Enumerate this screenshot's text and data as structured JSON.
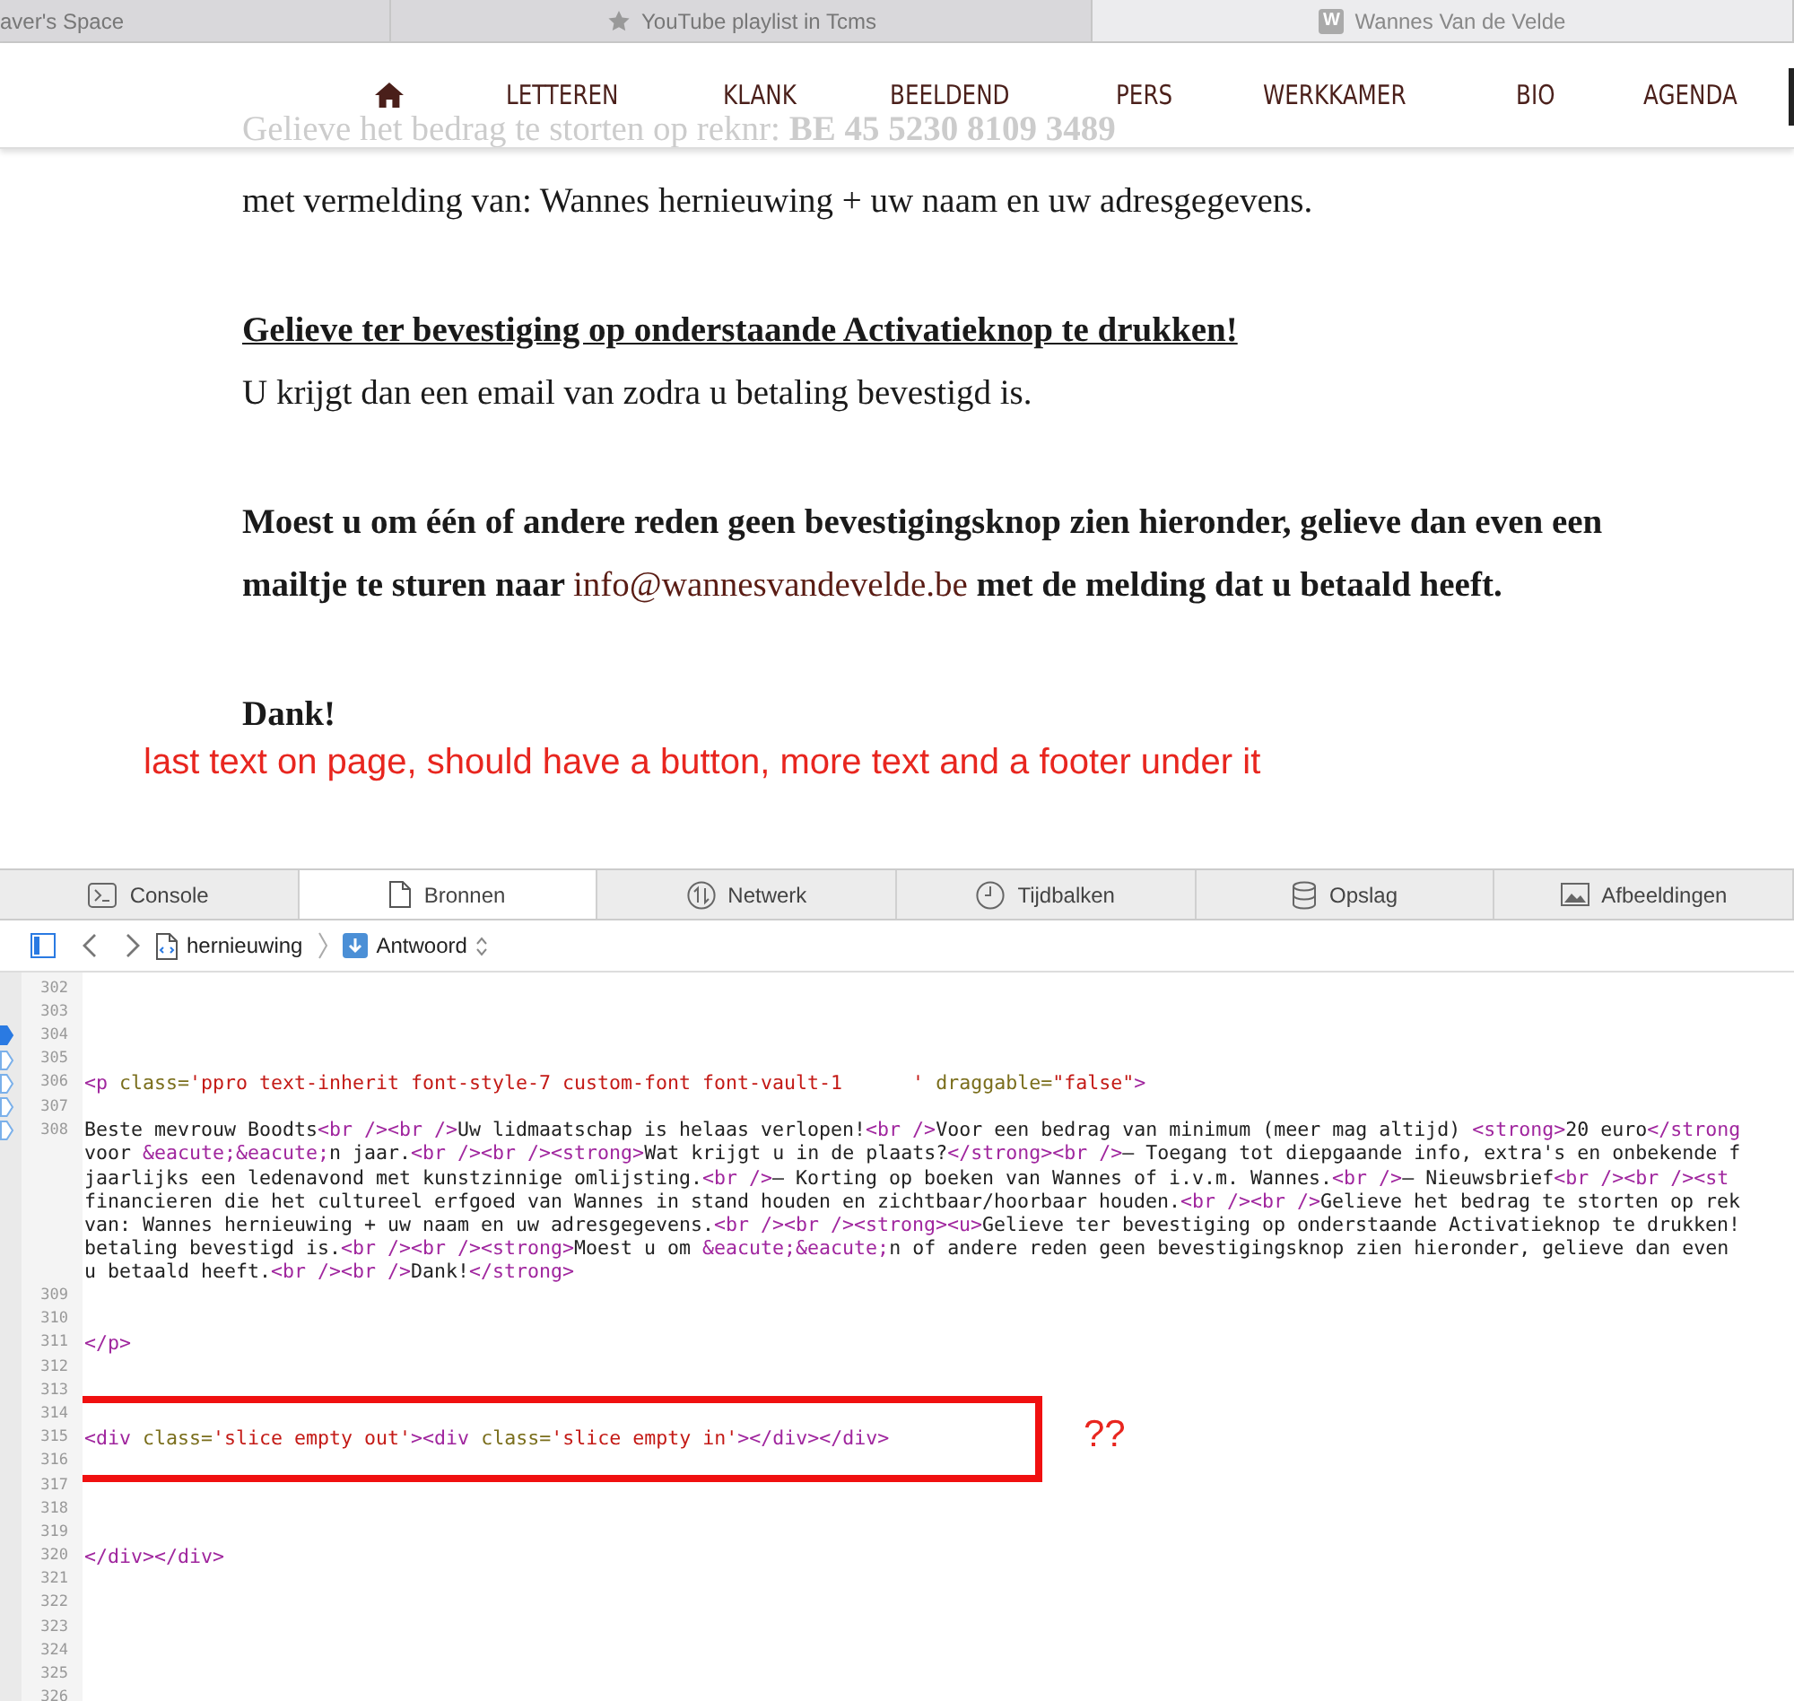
{
  "browser_tabs": [
    {
      "title": "aver's Space",
      "kind": "plain",
      "selected": false
    },
    {
      "title": "YouTube playlist in Tcms",
      "kind": "star",
      "selected": false
    },
    {
      "title": "Wannes Van de Velde",
      "kind": "letter",
      "icon_text": "W",
      "selected": true
    }
  ],
  "nav": {
    "items": [
      "LETTEREN",
      "KLANK",
      "BEELDEND",
      "PERS",
      "WERKKAMER",
      "BIO",
      "AGENDA"
    ]
  },
  "content": [
    {
      "kind": "faded",
      "text": "Gelieve het bedrag te storten op reknr: **BE 45 5230 8109 3489**"
    },
    {
      "kind": "plain",
      "text": "met vermelding van: Wannes hernieuwing + uw naam en uw adresgegevens."
    },
    {
      "kind": "gap"
    },
    {
      "kind": "underlined",
      "text": "Gelieve ter bevestiging op onderstaande Activatieknop te drukken!"
    },
    {
      "kind": "plain",
      "text": "U krijgt dan een email van zodra u betaling bevestigd is."
    },
    {
      "kind": "gap"
    },
    {
      "kind": "bold",
      "text": "Moest u om één of andere reden geen bevestigingsknop zien hieronder, gelieve dan even een mailtje te sturen naar ",
      "link": "info@wannesvandevelde.be",
      "after": " met de melding dat u betaald heeft."
    },
    {
      "kind": "gap"
    },
    {
      "kind": "bold",
      "text": "Dank!"
    }
  ],
  "annotation": "last text on page, should have a button, more text and a footer under it",
  "devtools": {
    "tabs": [
      {
        "label": "Console",
        "kind": "console",
        "selected": false
      },
      {
        "label": "Bronnen",
        "kind": "file",
        "selected": true
      },
      {
        "label": "Netwerk",
        "kind": "network",
        "selected": false
      },
      {
        "label": "Tijdbalken",
        "kind": "clock",
        "selected": false
      },
      {
        "label": "Opslag",
        "kind": "storage",
        "selected": false
      },
      {
        "label": "Afbeeldingen",
        "kind": "image",
        "selected": false
      }
    ],
    "breadcrumb": [
      {
        "label": "hernieuwing",
        "kind": "file",
        "chooser": false
      },
      {
        "label": "Antwoord",
        "kind": "download",
        "chooser": true
      }
    ],
    "lines": [
      {
        "number": "302"
      },
      {
        "number": "303"
      },
      {
        "number": "304",
        "breakpoint": true,
        "disabled": false
      },
      {
        "number": "305",
        "breakpoint": true,
        "disabled": true
      },
      {
        "number": "306",
        "breakpoint": true,
        "disabled": true,
        "tokens": [
          {
            "kind": "tag",
            "text": "<p "
          },
          {
            "kind": "attr",
            "text": "class="
          },
          {
            "kind": "value",
            "text": "'ppro text-inherit font-style-7 custom-font font-vault-1      '"
          },
          {
            "kind": "attr",
            "text": " draggable="
          },
          {
            "kind": "value",
            "text": "\"false\""
          },
          {
            "kind": "tag",
            "text": ">"
          }
        ]
      },
      {
        "number": "307",
        "breakpoint": true,
        "disabled": true
      },
      {
        "number": "308",
        "breakpoint": true,
        "disabled": true,
        "tokens": [
          {
            "kind": "text",
            "text": "Beste mevrouw Boodts"
          },
          {
            "kind": "tag",
            "text": "<br /><br />"
          },
          {
            "kind": "text",
            "text": "Uw lidmaatschap is helaas verlopen!"
          },
          {
            "kind": "tag",
            "text": "<br />"
          },
          {
            "kind": "text",
            "text": "Voor een bedrag van minimum (meer mag altijd) "
          },
          {
            "kind": "tag",
            "text": "<strong>"
          },
          {
            "kind": "text",
            "text": "20 euro"
          },
          {
            "kind": "tag",
            "text": "</strong"
          }
        ]
      },
      {
        "tokens": [
          {
            "kind": "text",
            "text": "voor "
          },
          {
            "kind": "tag",
            "text": "&eacute;&eacute;"
          },
          {
            "kind": "text",
            "text": "n jaar."
          },
          {
            "kind": "tag",
            "text": "<br /><br /><strong>"
          },
          {
            "kind": "text",
            "text": "Wat krijgt u in de plaats?"
          },
          {
            "kind": "tag",
            "text": "</strong><br />"
          },
          {
            "kind": "text",
            "text": "– Toegang tot diepgaande info, extra's en onbekende f"
          }
        ]
      },
      {
        "tokens": [
          {
            "kind": "text",
            "text": "jaarlijks een ledenavond met kunstzinnige omlijsting."
          },
          {
            "kind": "tag",
            "text": "<br />"
          },
          {
            "kind": "text",
            "text": "– Korting op boeken van Wannes of i.v.m. Wannes."
          },
          {
            "kind": "tag",
            "text": "<br />"
          },
          {
            "kind": "text",
            "text": "– Nieuwsbrief"
          },
          {
            "kind": "tag",
            "text": "<br /><br /><st"
          }
        ]
      },
      {
        "tokens": [
          {
            "kind": "text",
            "text": "financieren die het cultureel erfgoed van Wannes in stand houden en zichtbaar/hoorbaar houden."
          },
          {
            "kind": "tag",
            "text": "<br /><br />"
          },
          {
            "kind": "text",
            "text": "Gelieve het bedrag te storten op rek"
          }
        ]
      },
      {
        "tokens": [
          {
            "kind": "text",
            "text": "van: Wannes hernieuwing + uw naam en uw adresgegevens."
          },
          {
            "kind": "tag",
            "text": "<br /><br /><strong><u>"
          },
          {
            "kind": "text",
            "text": "Gelieve ter bevestiging op onderstaande Activatieknop te drukken!"
          }
        ]
      },
      {
        "tokens": [
          {
            "kind": "text",
            "text": "betaling bevestigd is."
          },
          {
            "kind": "tag",
            "text": "<br /><br /><strong>"
          },
          {
            "kind": "text",
            "text": "Moest u om "
          },
          {
            "kind": "tag",
            "text": "&eacute;&eacute;"
          },
          {
            "kind": "text",
            "text": "n of andere reden geen bevestigingsknop zien hieronder, gelieve dan even"
          }
        ]
      },
      {
        "tokens": [
          {
            "kind": "text",
            "text": "u betaald heeft."
          },
          {
            "kind": "tag",
            "text": "<br /><br />"
          },
          {
            "kind": "text",
            "text": "Dank!"
          },
          {
            "kind": "tag",
            "text": "</strong>"
          }
        ]
      },
      {
        "number": "309"
      },
      {
        "number": "310"
      },
      {
        "number": "311",
        "tokens": [
          {
            "kind": "tag",
            "text": "</p>"
          }
        ]
      },
      {
        "number": "312"
      },
      {
        "number": "313"
      },
      {
        "number": "314"
      },
      {
        "number": "315",
        "highlight": true,
        "tokens": [
          {
            "kind": "tag",
            "text": "<div "
          },
          {
            "kind": "attr",
            "text": "class="
          },
          {
            "kind": "value",
            "text": "'slice empty out'"
          },
          {
            "kind": "tag",
            "text": "><div "
          },
          {
            "kind": "attr",
            "text": "class="
          },
          {
            "kind": "value",
            "text": "'slice empty in'"
          },
          {
            "kind": "tag",
            "text": "></div></div>"
          }
        ]
      },
      {
        "number": "316"
      },
      {
        "number": "317"
      },
      {
        "number": "318"
      },
      {
        "number": "319"
      },
      {
        "number": "320",
        "tokens": [
          {
            "kind": "tag",
            "text": "</div></div>"
          }
        ]
      },
      {
        "number": "321"
      },
      {
        "number": "322"
      },
      {
        "number": "323"
      },
      {
        "number": "324"
      },
      {
        "number": "325"
      },
      {
        "number": "326"
      }
    ],
    "highlight_note": "??"
  }
}
